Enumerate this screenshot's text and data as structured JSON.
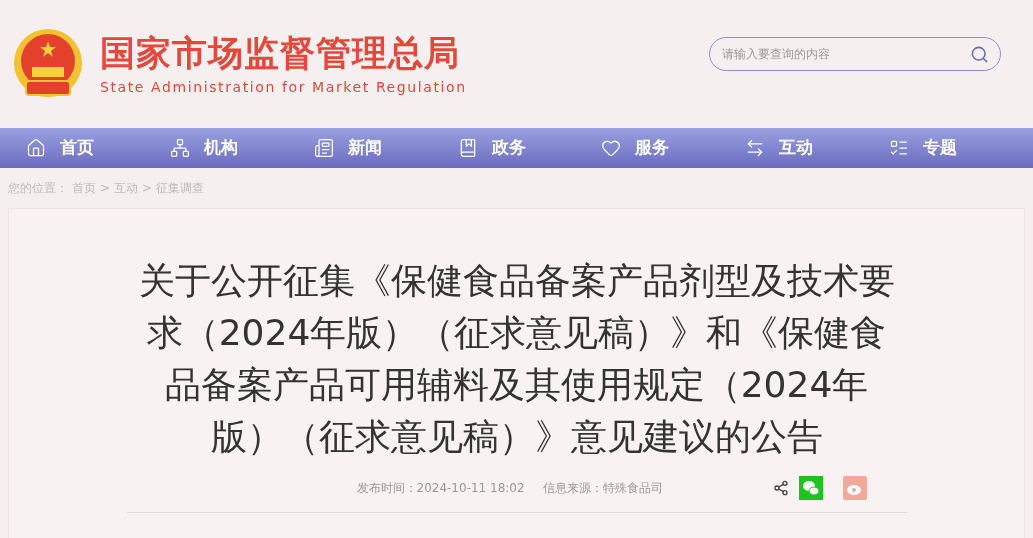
{
  "header": {
    "title_cn": "国家市场监督管理总局",
    "title_en": "State Administration for Market Regulation",
    "search": {
      "placeholder": "请输入要查询的内容"
    }
  },
  "nav": [
    {
      "label": "首页"
    },
    {
      "label": "机构"
    },
    {
      "label": "新闻"
    },
    {
      "label": "政务"
    },
    {
      "label": "服务"
    },
    {
      "label": "互动"
    },
    {
      "label": "专题"
    }
  ],
  "breadcrumb": {
    "prefix": "您的位置：",
    "items": [
      "首页",
      "互动",
      "征集调查"
    ],
    "separator": ">"
  },
  "article": {
    "title": "关于公开征集《保健食品备案产品剂型及技术要求（2024年版）（征求意见稿）》和《保健食品备案产品可用辅料及其使用规定（2024年版）（征求意见稿）》意见建议的公告",
    "published": "发布时间：2024-10-11 18:02",
    "source": "信息来源：特殊食品司"
  }
}
